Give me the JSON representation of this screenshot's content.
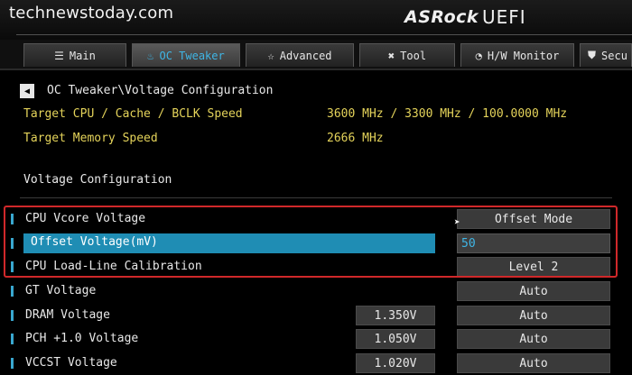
{
  "watermark": "technewstoday.com",
  "brand": {
    "name": "ASRock",
    "product": "UEFI"
  },
  "tabs": [
    {
      "label": "Main",
      "icon": "list-icon",
      "glyph": "☰",
      "active": false
    },
    {
      "label": "OC Tweaker",
      "icon": "flame-icon",
      "glyph": "♨",
      "active": true
    },
    {
      "label": "Advanced",
      "icon": "star-icon",
      "glyph": "☆",
      "active": false
    },
    {
      "label": "Tool",
      "icon": "tools-icon",
      "glyph": "✖",
      "active": false
    },
    {
      "label": "H/W Monitor",
      "icon": "monitor-icon",
      "glyph": "◔",
      "active": false
    },
    {
      "label": "Secu",
      "icon": "shield-icon",
      "glyph": "⛊",
      "active": false
    }
  ],
  "breadcrumb": "OC Tweaker\\Voltage Configuration",
  "info": [
    {
      "label": "Target CPU / Cache / BCLK Speed",
      "value": "3600 MHz / 3300 MHz / 100.0000 MHz"
    },
    {
      "label": "Target Memory Speed",
      "value": "2666 MHz"
    }
  ],
  "section_title": "Voltage Configuration",
  "settings": [
    {
      "label": "CPU Vcore Voltage",
      "option": "Offset Mode"
    },
    {
      "label": "Offset Voltage(mV)",
      "input_value": "50"
    },
    {
      "label": "CPU Load-Line Calibration",
      "option": "Level 2"
    },
    {
      "label": "GT Voltage",
      "option": "Auto"
    },
    {
      "label": "DRAM Voltage",
      "value": "1.350V",
      "option": "Auto"
    },
    {
      "label": "PCH +1.0 Voltage",
      "value": "1.050V",
      "option": "Auto"
    },
    {
      "label": "VCCST Voltage",
      "value": "1.020V",
      "option": "Auto"
    }
  ],
  "colors": {
    "accent": "#3fb6e6",
    "highlight": "#1f8db4",
    "info_text": "#e4d35a",
    "frame": "#d0282a"
  }
}
